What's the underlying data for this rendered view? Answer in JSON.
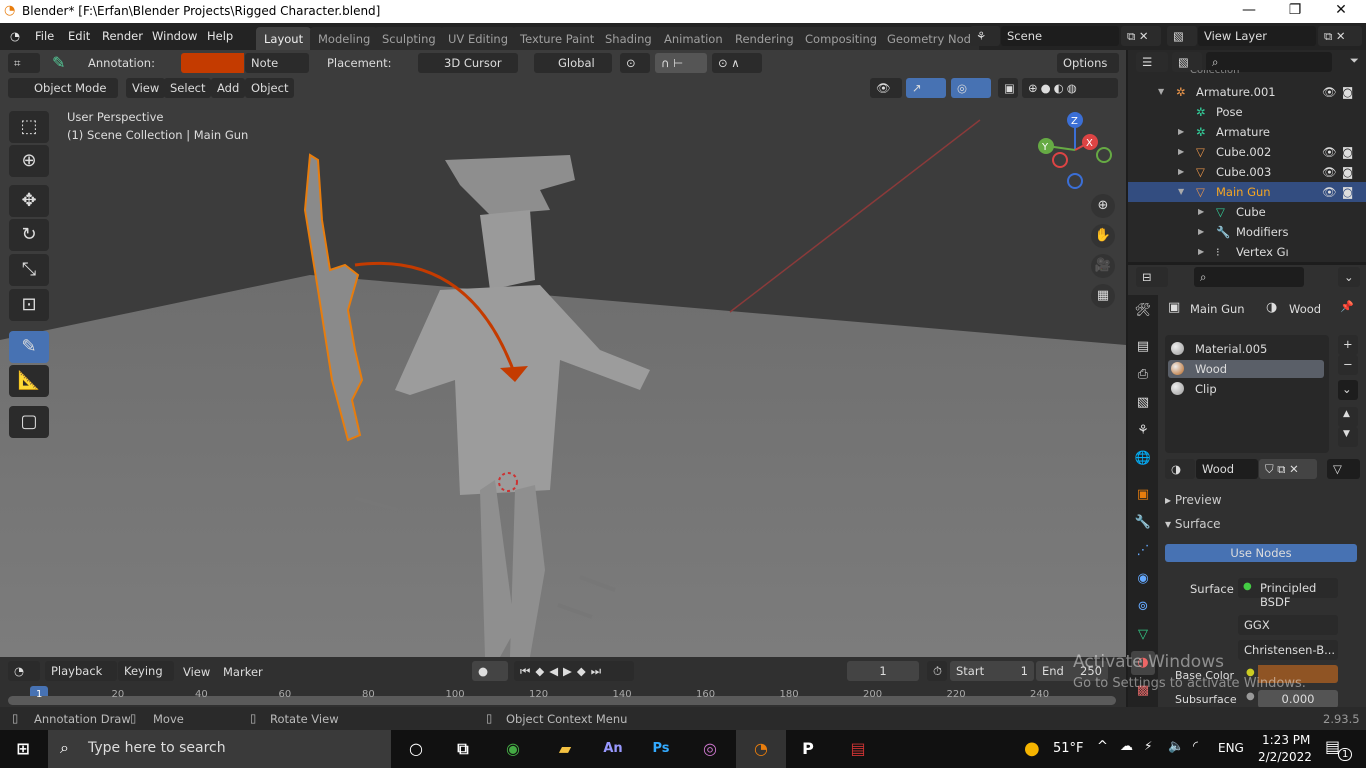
{
  "window": {
    "title": "Blender* [F:\\Erfan\\Blender Projects\\Rigged Character.blend]",
    "minimize": "—",
    "restore": "❐",
    "close": "✕"
  },
  "menu": [
    "File",
    "Edit",
    "Render",
    "Window",
    "Help"
  ],
  "workspaces": [
    {
      "label": "Layout",
      "active": true
    },
    {
      "label": "Modeling"
    },
    {
      "label": "Sculpting"
    },
    {
      "label": "UV Editing"
    },
    {
      "label": "Texture Paint"
    },
    {
      "label": "Shading"
    },
    {
      "label": "Animation"
    },
    {
      "label": "Rendering"
    },
    {
      "label": "Compositing"
    },
    {
      "label": "Geometry Nod"
    }
  ],
  "scene": {
    "name": "Scene",
    "view_layer": "View Layer"
  },
  "tool_header": {
    "annotation_label": "Annotation:",
    "annotation_color": "#c43b00",
    "layer": "Note",
    "placement_label": "Placement:",
    "placement": "3D Cursor",
    "orientation": "Global",
    "options": "Options"
  },
  "view_header": {
    "mode": "Object Mode",
    "items": [
      "View",
      "Select",
      "Add",
      "Object"
    ]
  },
  "viewport": {
    "perspective": "User Perspective",
    "collection": "(1) Scene Collection | Main Gun",
    "gizmo": {
      "z": "Z",
      "x": "X",
      "y": "Y"
    }
  },
  "outliner": {
    "partial": "Collection",
    "rows": [
      {
        "label": "Armature.001",
        "icon": "armature-icon",
        "indent": 0,
        "vis": true
      },
      {
        "label": "Pose",
        "icon": "pose-icon",
        "indent": 1
      },
      {
        "label": "Armature",
        "icon": "armature-data-icon",
        "indent": 1
      },
      {
        "label": "Cube.002",
        "icon": "mesh-icon",
        "indent": 1,
        "vis": true
      },
      {
        "label": "Cube.003",
        "icon": "mesh-icon",
        "indent": 1,
        "vis": true
      },
      {
        "label": "Main Gun",
        "icon": "mesh-icon",
        "indent": 1,
        "vis": true,
        "selected": true
      },
      {
        "label": "Cube",
        "icon": "mesh-data-icon",
        "indent": 2
      },
      {
        "label": "Modifiers",
        "icon": "wrench-icon",
        "indent": 2
      },
      {
        "label": "Vertex Gı",
        "icon": "vertex-groups-icon",
        "indent": 2
      }
    ]
  },
  "properties": {
    "breadcrumb": {
      "object": "Main Gun",
      "material": "Wood"
    },
    "slots": [
      {
        "label": "Material.005",
        "color": "#9a9a9a"
      },
      {
        "label": "Wood",
        "color": "#b8651e",
        "selected": true
      },
      {
        "label": "Clip",
        "color": "#9a9a9a"
      }
    ],
    "material_name": "Wood",
    "preview": "Preview",
    "surface_panel": "Surface",
    "use_nodes": "Use Nodes",
    "surface_label": "Surface",
    "surface_value": "Principled BSDF",
    "distribution": "GGX",
    "subsurface_method": "Christensen-B...",
    "base_color_label": "Base Color",
    "base_color": "#8f5424",
    "subsurface_label": "Subsurface",
    "subsurface_value": "0.000"
  },
  "timeline": {
    "items": [
      "Playback",
      "Keying",
      "View",
      "Marker"
    ],
    "current_frame": "1",
    "start_label": "Start",
    "start": "1",
    "end_label": "End",
    "end": "250",
    "ticks": [
      "1",
      "20",
      "40",
      "60",
      "80",
      "100",
      "120",
      "140",
      "160",
      "180",
      "200",
      "220",
      "240"
    ]
  },
  "status": {
    "hints": [
      "Annotation Draw",
      "Move",
      "Rotate View",
      "Object Context Menu"
    ],
    "version": "2.93.5"
  },
  "watermark": {
    "line1": "Activate Windows",
    "line2": "Go to Settings to activate Windows."
  },
  "taskbar": {
    "search_placeholder": "Type here to search",
    "weather": "51°F",
    "lang": "ENG",
    "time": "1:23 PM",
    "date": "2/2/2022",
    "notifications": "1"
  }
}
